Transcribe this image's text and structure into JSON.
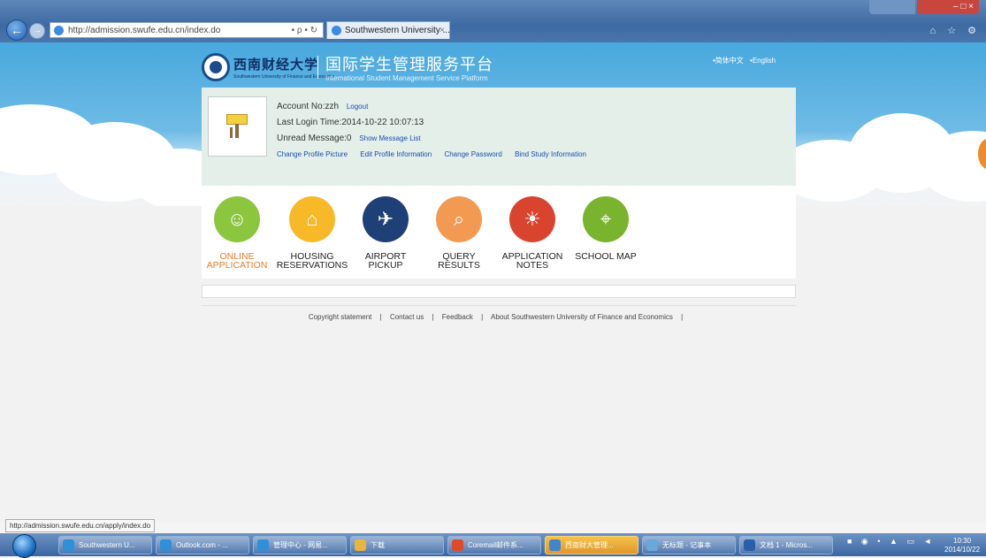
{
  "browser": {
    "url": "http://admission.swufe.edu.cn/index.do",
    "address_tools": "• ρ • ↻",
    "tab_title": "Southwestern University ...",
    "tab_close": "×",
    "window_controls": "–  □  ×",
    "toolbar_icons": "⌂ ☆ ⚙"
  },
  "header": {
    "logo_cn": "西南财经大学",
    "logo_en": "Southwestern University of Finance and Economics",
    "platform_cn": "国际学生管理服务平台",
    "platform_en": "International Student Management Service Platform",
    "lang_cn": "•简体中文",
    "lang_en": "•English"
  },
  "profile": {
    "account": "Account No:zzh",
    "logout": "Logout",
    "last_login": "Last Login Time:2014-10-22 10:07:13",
    "unread": "Unread Message:0",
    "show_messages": "Show Message List",
    "links": [
      "Change Profile Picture",
      "Edit Profile Information",
      "Change Password",
      "Bind Study Information"
    ]
  },
  "services": [
    {
      "label": "ONLINE\nAPPLICATION",
      "icon": "user-icon",
      "glyph": "☺",
      "color": "#8cc63f"
    },
    {
      "label": "HOUSING\nRESERVATIONS",
      "icon": "home-icon",
      "glyph": "⌂",
      "color": "#f7b928"
    },
    {
      "label": "AIRPORT\nPICKUP",
      "icon": "airplane-icon",
      "glyph": "✈",
      "color": "#1f3f77"
    },
    {
      "label": "QUERY\nRESULTS",
      "icon": "search-icon",
      "glyph": "⌕",
      "color": "#f39a52"
    },
    {
      "label": "APPLICATION\nNOTES",
      "icon": "lightbulb-icon",
      "glyph": "☀",
      "color": "#d9442f"
    },
    {
      "label": "SCHOOL MAP",
      "icon": "map-pin-icon",
      "glyph": "⌖",
      "color": "#7ab32e"
    }
  ],
  "footer": {
    "items": [
      "Copyright statement",
      "Contact us",
      "Feedback",
      "About Southwestern University of Finance and Economics"
    ],
    "separator": "|"
  },
  "status_bar": {
    "url": "http://admission.swufe.edu.cn/apply/index.do"
  },
  "taskbar": {
    "tasks": [
      {
        "label": "Southwestern U...",
        "color": "#2f8fd8"
      },
      {
        "label": "Outlook.com - ...",
        "color": "#2f8fd8"
      },
      {
        "label": "管理中心 - 网易...",
        "color": "#2f8fd8"
      },
      {
        "label": "下载",
        "color": "#e8b63a"
      },
      {
        "label": "Coremail邮件系...",
        "color": "#e04a2a"
      },
      {
        "label": "西南财大管理...",
        "color": "#3f86d0"
      },
      {
        "label": "无标题 - 记事本",
        "color": "#6aa8d8"
      },
      {
        "label": "文档 1 - Micros...",
        "color": "#2a5fa8"
      }
    ],
    "tray_icons": "■ ◉ • ▲ ▭ ◄",
    "time": "10:30",
    "date": "2014/10/22"
  }
}
